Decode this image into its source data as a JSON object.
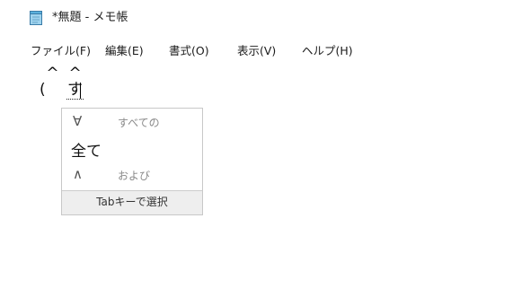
{
  "window": {
    "title": "*無題 - メモ帳"
  },
  "menu": {
    "file": "ファイル(F)",
    "edit": "編集(E)",
    "format": "書式(O)",
    "view": "表示(V)",
    "help": "ヘルプ(H)"
  },
  "editor": {
    "line1": " ^  ^",
    "line2_prefix": "(",
    "composition": "す"
  },
  "suggestions": {
    "items": [
      {
        "symbol": "∀",
        "description": "すべての"
      },
      {
        "text": "全て"
      },
      {
        "symbol": "∧",
        "description": "および"
      }
    ],
    "footer": "Tabキーで選択"
  },
  "icons": {
    "app": "notepad-icon"
  }
}
